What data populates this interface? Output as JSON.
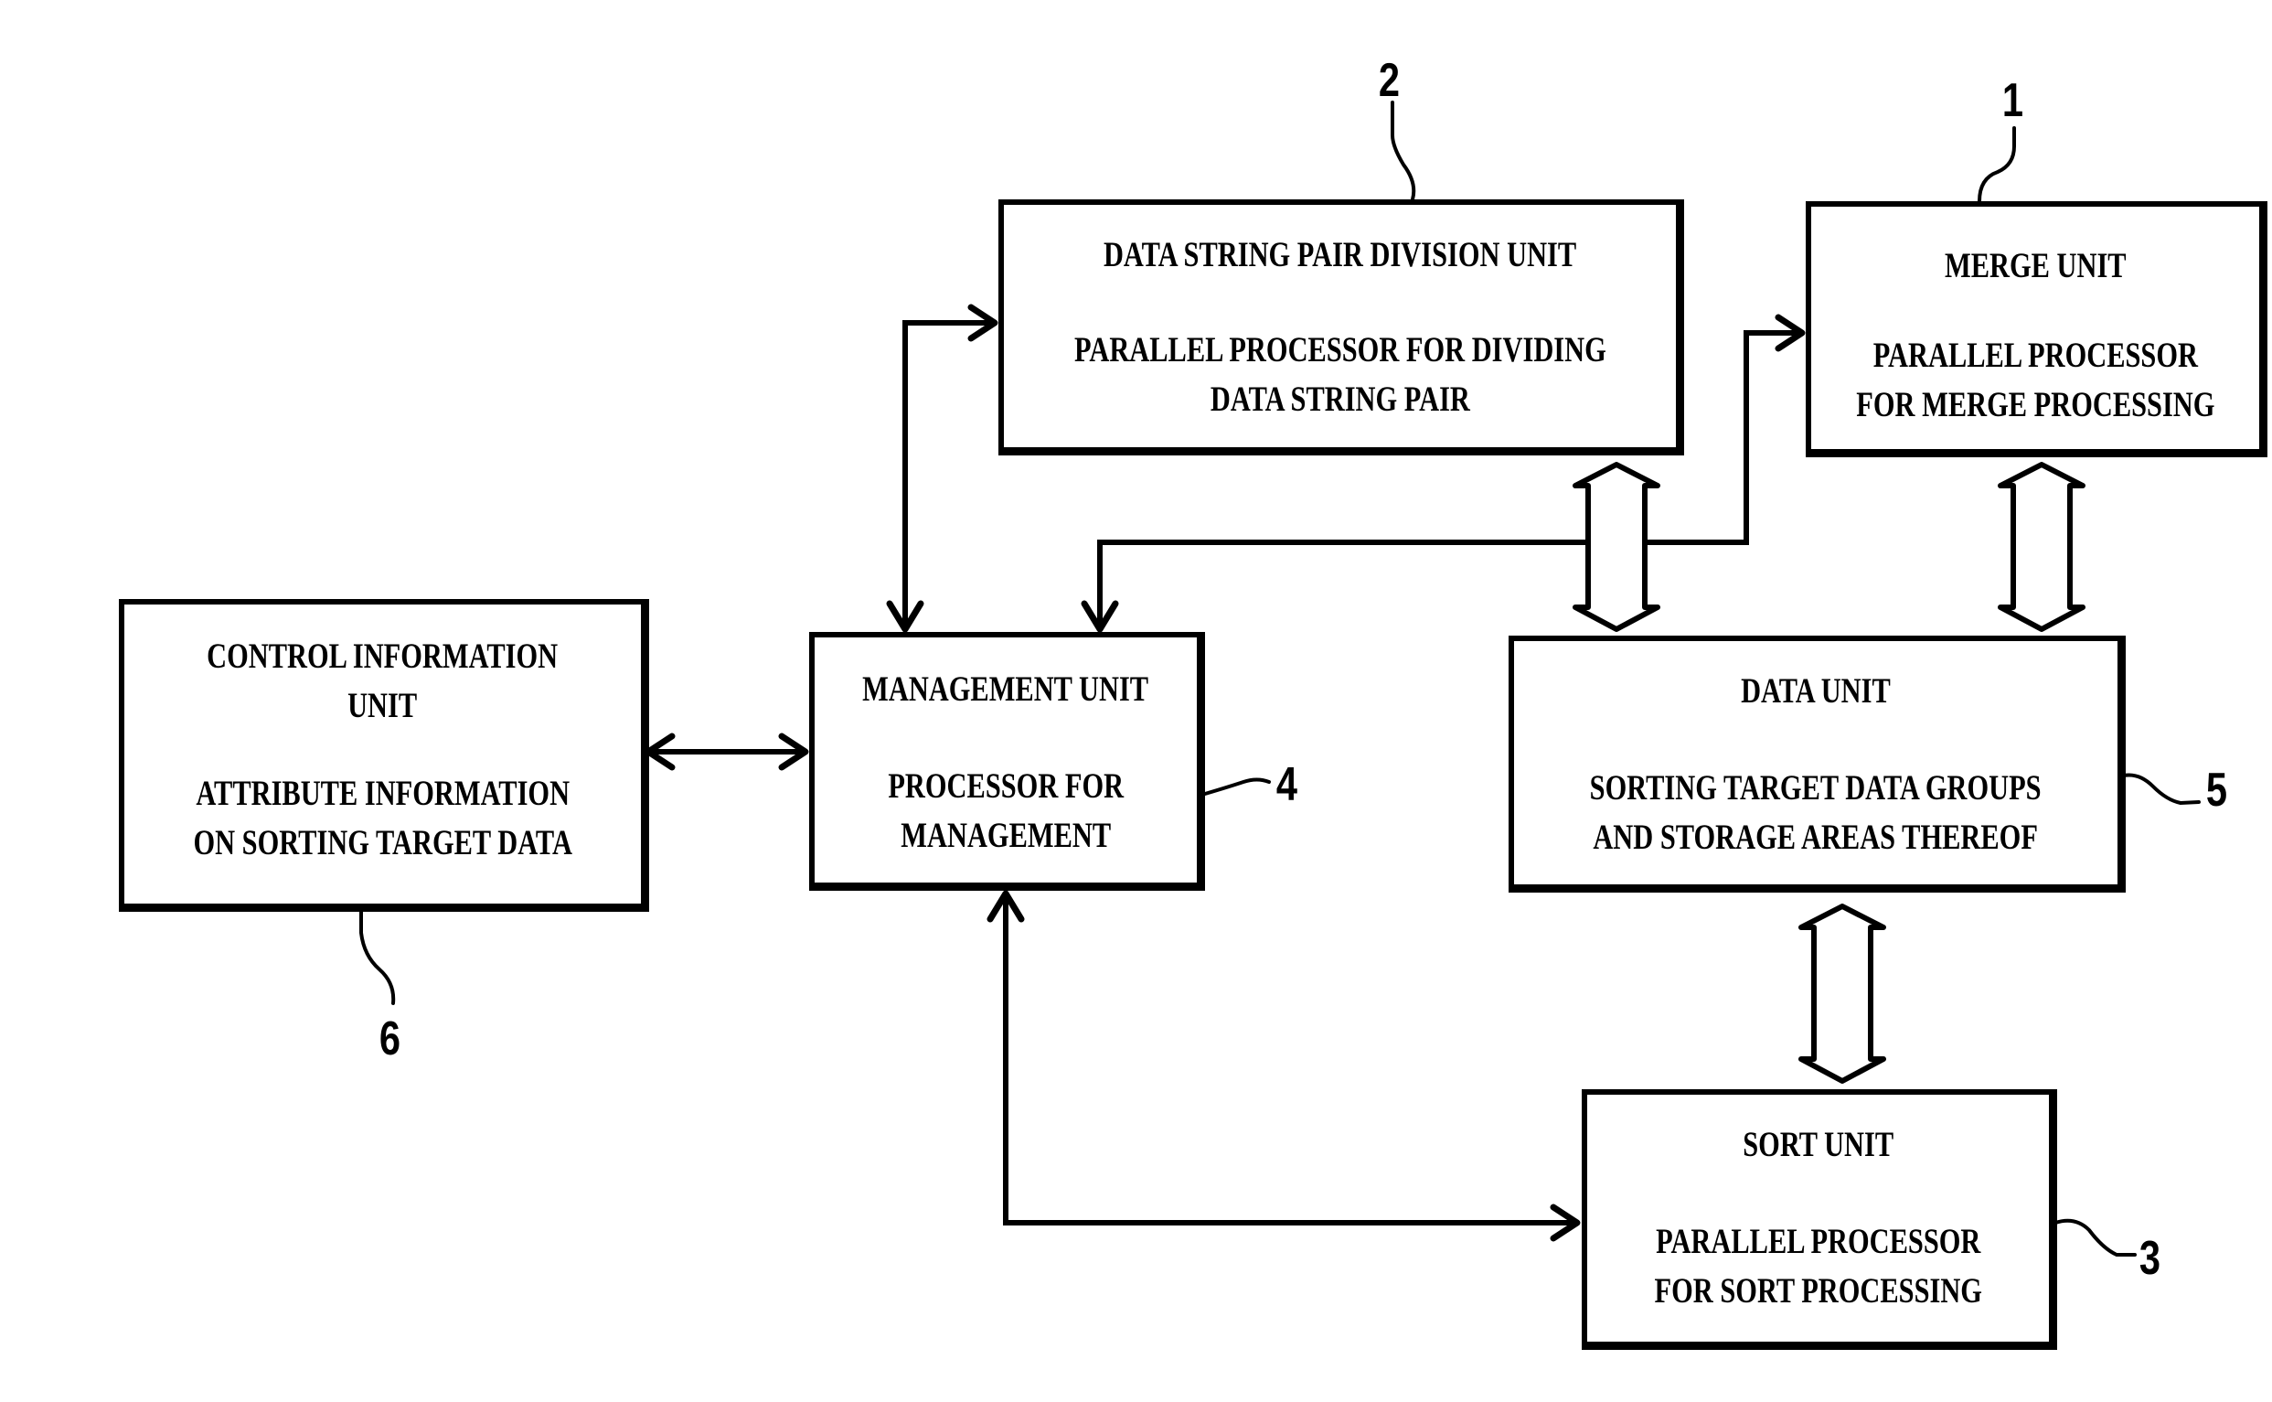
{
  "figure": {
    "units": {
      "merge": {
        "ref": "1",
        "title": [
          "MERGE UNIT"
        ],
        "desc": [
          "PARALLEL PROCESSOR",
          "FOR MERGE PROCESSING"
        ]
      },
      "division": {
        "ref": "2",
        "title": [
          "DATA STRING PAIR DIVISION UNIT"
        ],
        "desc": [
          "PARALLEL PROCESSOR FOR DIVIDING",
          "DATA STRING PAIR"
        ]
      },
      "sort": {
        "ref": "3",
        "title": [
          "SORT UNIT"
        ],
        "desc": [
          "PARALLEL PROCESSOR",
          "FOR SORT PROCESSING"
        ]
      },
      "management": {
        "ref": "4",
        "title": [
          "MANAGEMENT UNIT"
        ],
        "desc": [
          "PROCESSOR FOR",
          "MANAGEMENT"
        ]
      },
      "data": {
        "ref": "5",
        "title": [
          "DATA UNIT"
        ],
        "desc": [
          "SORTING TARGET DATA GROUPS",
          "AND STORAGE AREAS THEREOF"
        ]
      },
      "control": {
        "ref": "6",
        "title": [
          "CONTROL INFORMATION",
          "UNIT"
        ],
        "desc": [
          "ATTRIBUTE INFORMATION",
          "ON SORTING TARGET DATA"
        ]
      }
    },
    "connections": [
      {
        "from": "management",
        "to": "division",
        "type": "bidirectional-line"
      },
      {
        "from": "management",
        "to": "merge",
        "type": "bidirectional-line"
      },
      {
        "from": "management",
        "to": "control",
        "type": "bidirectional-line"
      },
      {
        "from": "management",
        "to": "sort",
        "type": "bidirectional-line"
      },
      {
        "from": "division",
        "to": "data",
        "type": "bidirectional-bus"
      },
      {
        "from": "merge",
        "to": "data",
        "type": "bidirectional-bus"
      },
      {
        "from": "data",
        "to": "sort",
        "type": "bidirectional-bus"
      }
    ]
  }
}
